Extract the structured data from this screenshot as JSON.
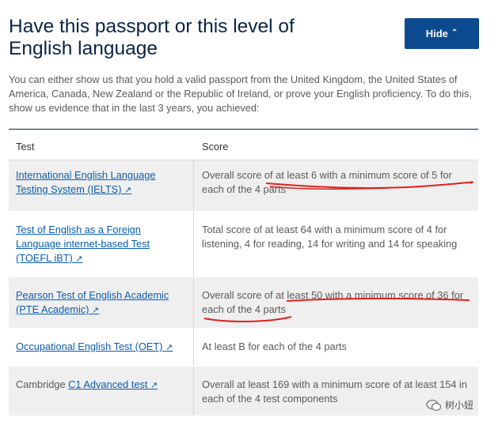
{
  "header": {
    "title": "Have this passport or this level of English language",
    "hide_label": "Hide",
    "hide_icon": "chevron-up-icon"
  },
  "intro": "You can either show us that you hold a valid passport from the United Kingdom, the United States of America, Canada, New Zealand or the Republic of Ireland, or prove your English proficiency. To do this, show us evidence that in the last 3 years, you achieved:",
  "table": {
    "headers": [
      "Test",
      "Score"
    ],
    "rows": [
      {
        "prefix": "",
        "link": "International English Language Testing System (IELTS)",
        "score": "Overall score of at least 6 with a minimum score of 5 for each of the 4 parts"
      },
      {
        "prefix": "",
        "link": "Test of English as a Foreign Language internet-based Test (TOEFL iBT)",
        "score": "Total score of at least 64 with a minimum score of 4 for listening, 4 for reading, 14 for writing and 14 for speaking"
      },
      {
        "prefix": "",
        "link": "Pearson Test of English Academic (PTE Academic)",
        "score": "Overall score of at least 50 with a minimum score of 36 for each of the 4 parts"
      },
      {
        "prefix": "",
        "link": "Occupational English Test (OET)",
        "score": "At least B for each of the 4 parts"
      },
      {
        "prefix": "Cambridge ",
        "link": "C1 Advanced test",
        "score": "Overall at least 169 with a minimum score of at least 154 in each of the 4 test components"
      }
    ],
    "external_glyph": "↗"
  },
  "watermark": {
    "text": "树小妞"
  },
  "colors": {
    "title": "#0b2447",
    "button": "#0b4a8f",
    "link": "#0a5db0",
    "annotation": "#e0201c",
    "row_alt": "#efefef"
  }
}
